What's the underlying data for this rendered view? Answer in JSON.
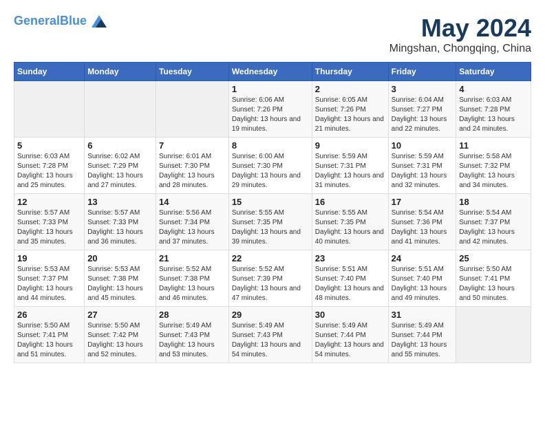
{
  "header": {
    "logo_line1": "General",
    "logo_line2": "Blue",
    "month_title": "May 2024",
    "location": "Mingshan, Chongqing, China"
  },
  "weekdays": [
    "Sunday",
    "Monday",
    "Tuesday",
    "Wednesday",
    "Thursday",
    "Friday",
    "Saturday"
  ],
  "weeks": [
    [
      {
        "day": "",
        "info": ""
      },
      {
        "day": "",
        "info": ""
      },
      {
        "day": "",
        "info": ""
      },
      {
        "day": "1",
        "info": "Sunrise: 6:06 AM\nSunset: 7:26 PM\nDaylight: 13 hours\nand 19 minutes."
      },
      {
        "day": "2",
        "info": "Sunrise: 6:05 AM\nSunset: 7:26 PM\nDaylight: 13 hours\nand 21 minutes."
      },
      {
        "day": "3",
        "info": "Sunrise: 6:04 AM\nSunset: 7:27 PM\nDaylight: 13 hours\nand 22 minutes."
      },
      {
        "day": "4",
        "info": "Sunrise: 6:03 AM\nSunset: 7:28 PM\nDaylight: 13 hours\nand 24 minutes."
      }
    ],
    [
      {
        "day": "5",
        "info": "Sunrise: 6:03 AM\nSunset: 7:28 PM\nDaylight: 13 hours\nand 25 minutes."
      },
      {
        "day": "6",
        "info": "Sunrise: 6:02 AM\nSunset: 7:29 PM\nDaylight: 13 hours\nand 27 minutes."
      },
      {
        "day": "7",
        "info": "Sunrise: 6:01 AM\nSunset: 7:30 PM\nDaylight: 13 hours\nand 28 minutes."
      },
      {
        "day": "8",
        "info": "Sunrise: 6:00 AM\nSunset: 7:30 PM\nDaylight: 13 hours\nand 29 minutes."
      },
      {
        "day": "9",
        "info": "Sunrise: 5:59 AM\nSunset: 7:31 PM\nDaylight: 13 hours\nand 31 minutes."
      },
      {
        "day": "10",
        "info": "Sunrise: 5:59 AM\nSunset: 7:31 PM\nDaylight: 13 hours\nand 32 minutes."
      },
      {
        "day": "11",
        "info": "Sunrise: 5:58 AM\nSunset: 7:32 PM\nDaylight: 13 hours\nand 34 minutes."
      }
    ],
    [
      {
        "day": "12",
        "info": "Sunrise: 5:57 AM\nSunset: 7:33 PM\nDaylight: 13 hours\nand 35 minutes."
      },
      {
        "day": "13",
        "info": "Sunrise: 5:57 AM\nSunset: 7:33 PM\nDaylight: 13 hours\nand 36 minutes."
      },
      {
        "day": "14",
        "info": "Sunrise: 5:56 AM\nSunset: 7:34 PM\nDaylight: 13 hours\nand 37 minutes."
      },
      {
        "day": "15",
        "info": "Sunrise: 5:55 AM\nSunset: 7:35 PM\nDaylight: 13 hours\nand 39 minutes."
      },
      {
        "day": "16",
        "info": "Sunrise: 5:55 AM\nSunset: 7:35 PM\nDaylight: 13 hours\nand 40 minutes."
      },
      {
        "day": "17",
        "info": "Sunrise: 5:54 AM\nSunset: 7:36 PM\nDaylight: 13 hours\nand 41 minutes."
      },
      {
        "day": "18",
        "info": "Sunrise: 5:54 AM\nSunset: 7:37 PM\nDaylight: 13 hours\nand 42 minutes."
      }
    ],
    [
      {
        "day": "19",
        "info": "Sunrise: 5:53 AM\nSunset: 7:37 PM\nDaylight: 13 hours\nand 44 minutes."
      },
      {
        "day": "20",
        "info": "Sunrise: 5:53 AM\nSunset: 7:38 PM\nDaylight: 13 hours\nand 45 minutes."
      },
      {
        "day": "21",
        "info": "Sunrise: 5:52 AM\nSunset: 7:38 PM\nDaylight: 13 hours\nand 46 minutes."
      },
      {
        "day": "22",
        "info": "Sunrise: 5:52 AM\nSunset: 7:39 PM\nDaylight: 13 hours\nand 47 minutes."
      },
      {
        "day": "23",
        "info": "Sunrise: 5:51 AM\nSunset: 7:40 PM\nDaylight: 13 hours\nand 48 minutes."
      },
      {
        "day": "24",
        "info": "Sunrise: 5:51 AM\nSunset: 7:40 PM\nDaylight: 13 hours\nand 49 minutes."
      },
      {
        "day": "25",
        "info": "Sunrise: 5:50 AM\nSunset: 7:41 PM\nDaylight: 13 hours\nand 50 minutes."
      }
    ],
    [
      {
        "day": "26",
        "info": "Sunrise: 5:50 AM\nSunset: 7:41 PM\nDaylight: 13 hours\nand 51 minutes."
      },
      {
        "day": "27",
        "info": "Sunrise: 5:50 AM\nSunset: 7:42 PM\nDaylight: 13 hours\nand 52 minutes."
      },
      {
        "day": "28",
        "info": "Sunrise: 5:49 AM\nSunset: 7:43 PM\nDaylight: 13 hours\nand 53 minutes."
      },
      {
        "day": "29",
        "info": "Sunrise: 5:49 AM\nSunset: 7:43 PM\nDaylight: 13 hours\nand 54 minutes."
      },
      {
        "day": "30",
        "info": "Sunrise: 5:49 AM\nSunset: 7:44 PM\nDaylight: 13 hours\nand 54 minutes."
      },
      {
        "day": "31",
        "info": "Sunrise: 5:49 AM\nSunset: 7:44 PM\nDaylight: 13 hours\nand 55 minutes."
      },
      {
        "day": "",
        "info": ""
      }
    ]
  ]
}
